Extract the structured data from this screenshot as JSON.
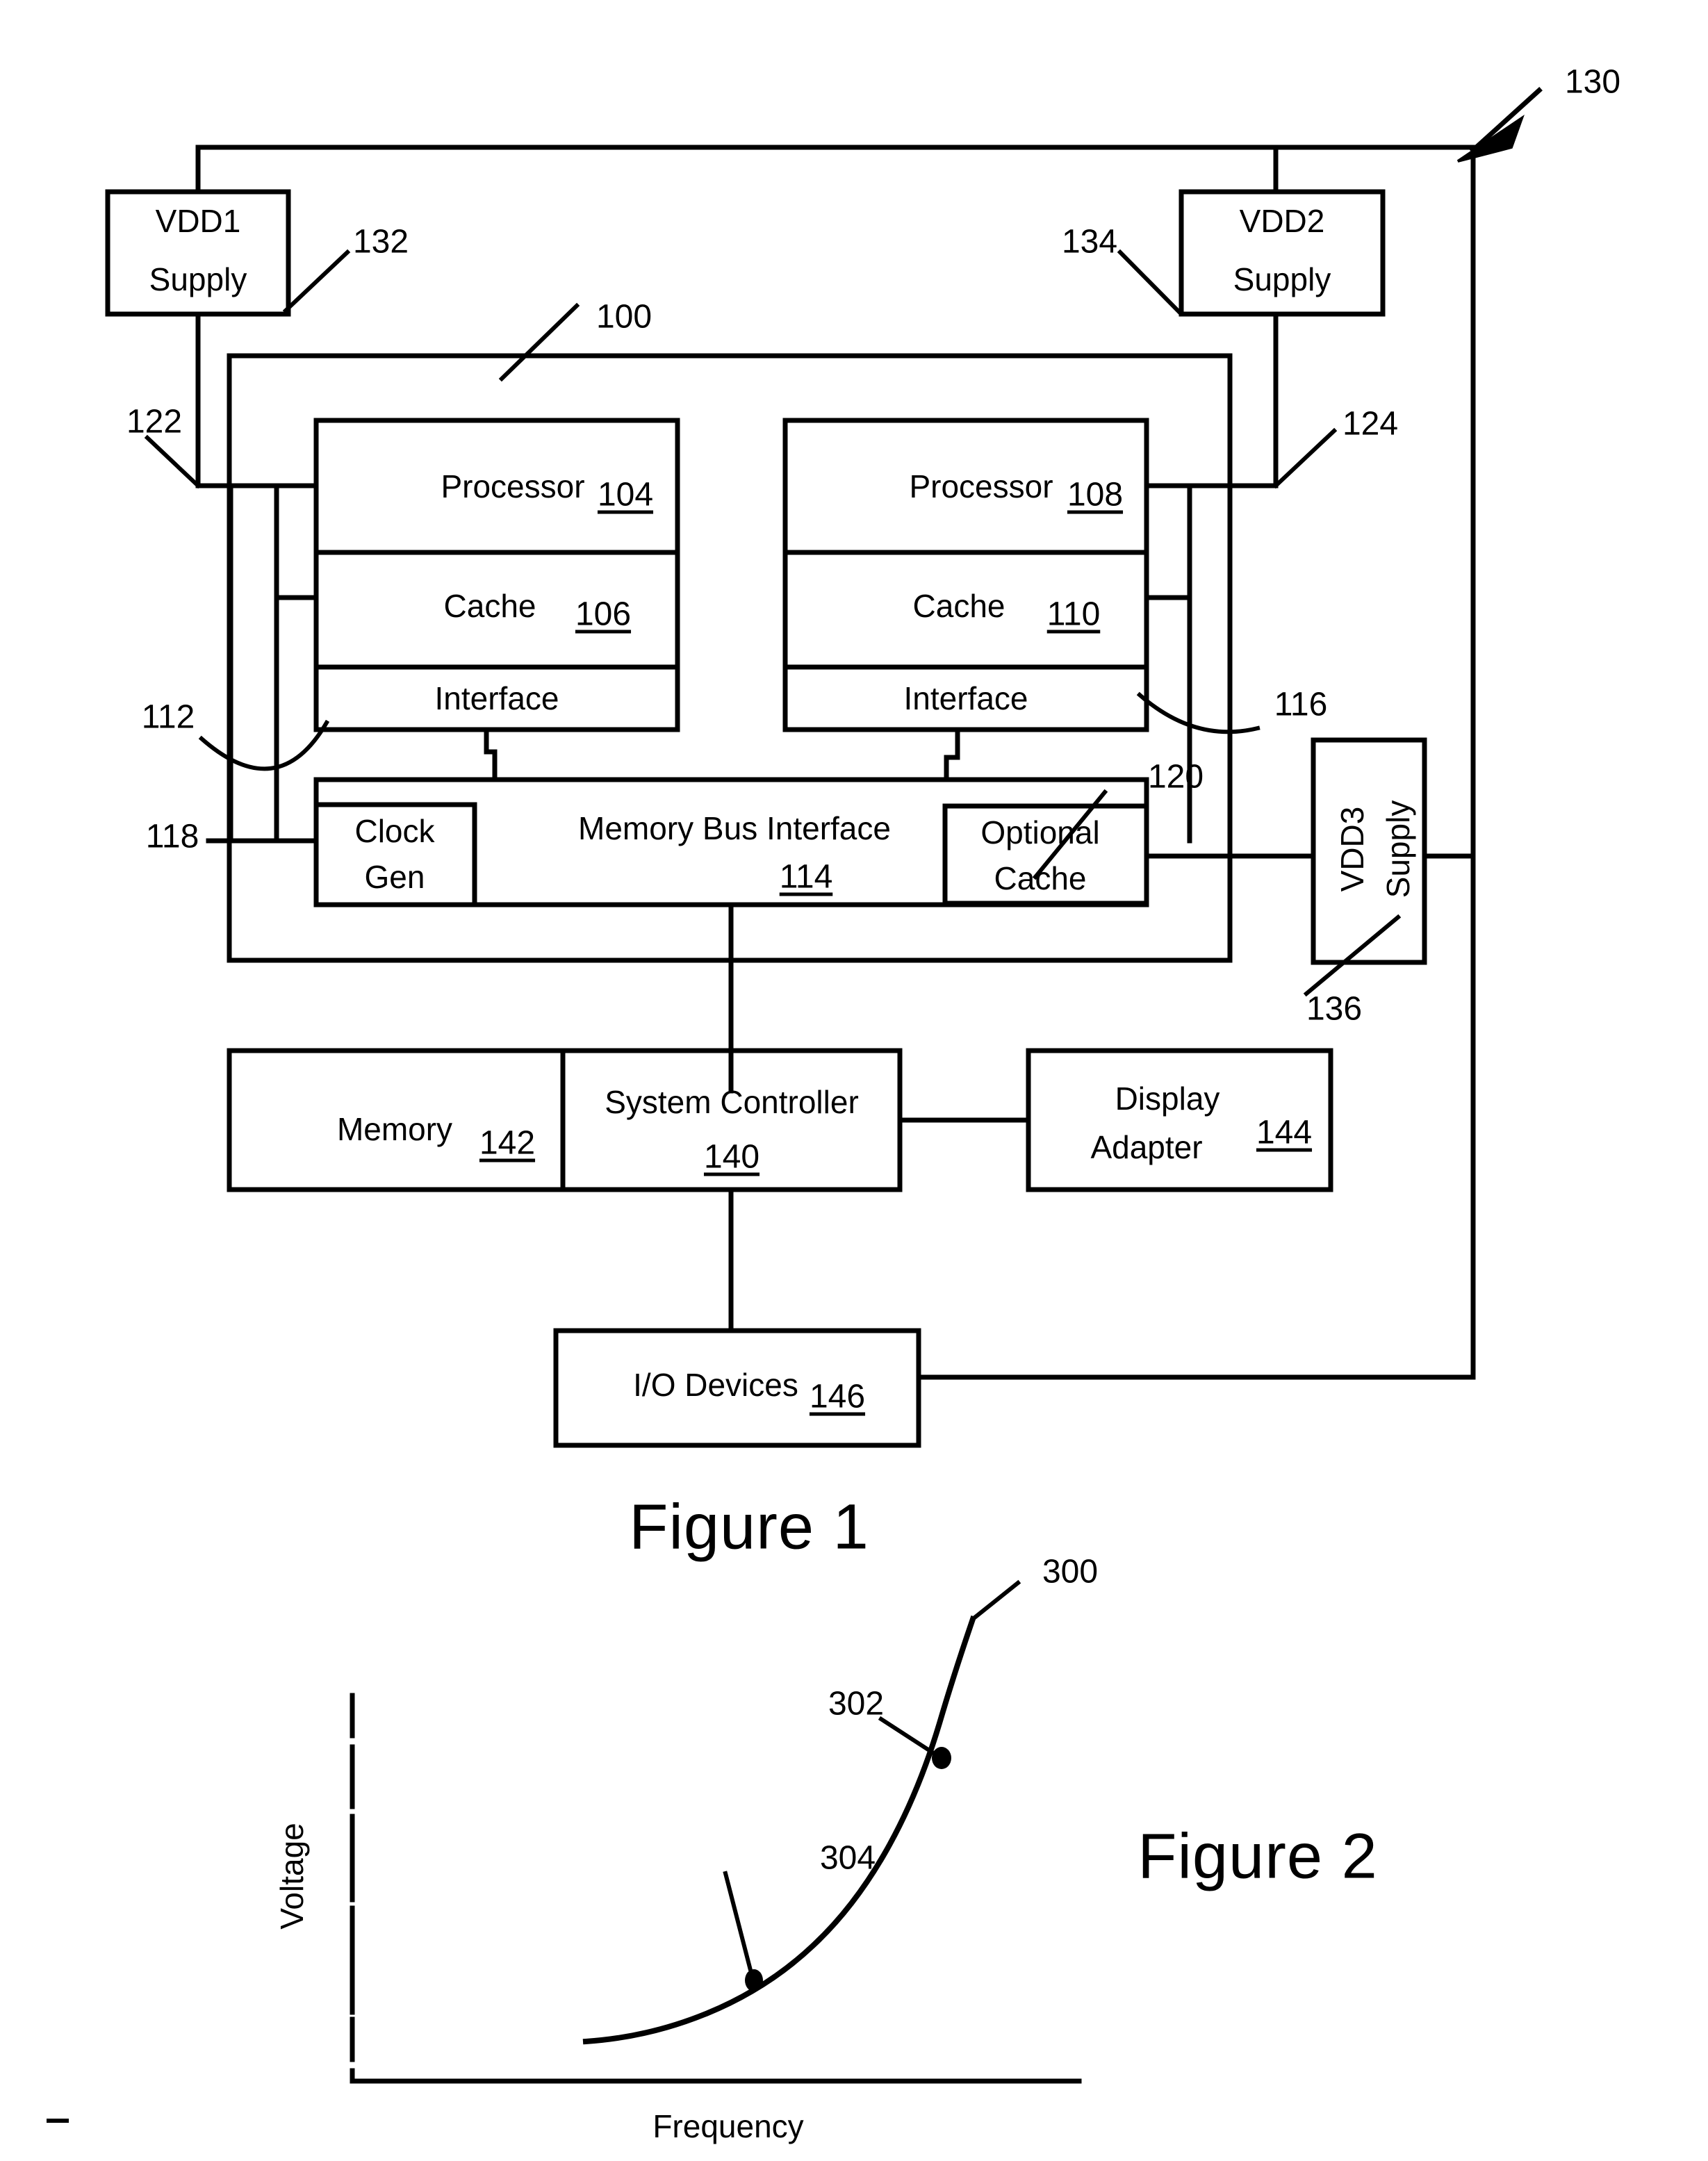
{
  "figure1": {
    "title": "Figure 1",
    "system_ref": "130",
    "chip_ref": "100",
    "supplies": [
      {
        "name": "vdd1",
        "line1": "VDD1",
        "line2": "Supply",
        "ref": "132"
      },
      {
        "name": "vdd2",
        "line1": "VDD2",
        "line2": "Supply",
        "ref": "134"
      },
      {
        "name": "vdd3",
        "line1": "VDD3",
        "line2": "Supply",
        "ref": "136"
      }
    ],
    "cores": [
      {
        "processor_label": "Processor",
        "processor_ref": "104",
        "cache_label": "Cache",
        "cache_ref": "106",
        "interface_label": "Interface",
        "interface_ref": "112",
        "rail_ref": "122"
      },
      {
        "processor_label": "Processor",
        "processor_ref": "108",
        "cache_label": "Cache",
        "cache_ref": "110",
        "interface_label": "Interface",
        "interface_ref": "116",
        "rail_ref": "124"
      }
    ],
    "memory_bus": {
      "label": "Memory Bus Interface",
      "ref": "114"
    },
    "clock_gen": {
      "line1": "Clock",
      "line2": "Gen",
      "ref": "118"
    },
    "optional_cache": {
      "line1": "Optional",
      "line2": "Cache",
      "ref": "120"
    },
    "memory": {
      "label": "Memory",
      "ref": "142"
    },
    "system_controller": {
      "label": "System Controller",
      "ref": "140"
    },
    "display_adapter": {
      "line1": "Display",
      "line2": "Adapter",
      "ref": "144"
    },
    "io_devices": {
      "label": "I/O Devices",
      "ref": "146"
    }
  },
  "figure2": {
    "title": "Figure 2",
    "curve_ref": "300",
    "point_high_ref": "302",
    "point_low_ref": "304"
  },
  "chart_data": {
    "type": "line",
    "title": "",
    "xlabel": "Frequency",
    "ylabel": "Voltage",
    "grid": false,
    "legend": "none",
    "xlim": [
      0,
      1
    ],
    "ylim": [
      0,
      1
    ],
    "axis_ticks_visible": false,
    "series": [
      {
        "name": "300",
        "label": "voltage-frequency curve",
        "x": [
          0.33,
          0.42,
          0.52,
          0.62,
          0.71,
          0.79,
          0.86,
          0.91,
          0.95,
          0.98
        ],
        "y": [
          0.08,
          0.11,
          0.16,
          0.24,
          0.35,
          0.49,
          0.64,
          0.78,
          0.9,
          1.0
        ]
      }
    ],
    "annotations": [
      {
        "ref": "300",
        "text": "300",
        "target": "curve-upper-end"
      },
      {
        "ref": "302",
        "text": "302",
        "point": {
          "x": 0.855,
          "y": 0.655
        }
      },
      {
        "ref": "304",
        "text": "304",
        "point": {
          "x": 0.585,
          "y": 0.215
        }
      }
    ]
  }
}
